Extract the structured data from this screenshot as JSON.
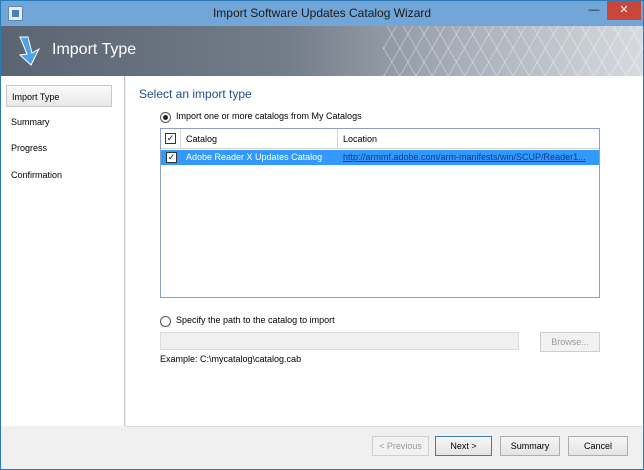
{
  "window": {
    "title": "Import Software Updates Catalog Wizard",
    "minimize_glyph": "—",
    "close_glyph": "✕"
  },
  "banner": {
    "title": "Import Type",
    "icon": "arrow-down-icon"
  },
  "sidebar": {
    "items": [
      {
        "label": "Import Type",
        "active": true
      },
      {
        "label": "Summary"
      },
      {
        "label": "Progress"
      },
      {
        "label": "Confirmation"
      }
    ]
  },
  "main": {
    "heading": "Select an import type",
    "option_mycatalogs": {
      "label": "Import one or more catalogs from My Catalogs",
      "selected": true
    },
    "table": {
      "columns": [
        "Catalog",
        "Location"
      ],
      "header_checked": true,
      "rows": [
        {
          "checked": true,
          "catalog": "Adobe Reader X Updates Catalog",
          "location": "http://armmf.adobe.com/arm-manifests/win/SCUP/Reader1..."
        }
      ]
    },
    "option_path": {
      "label": "Specify the path to the catalog to import",
      "selected": false
    },
    "path_value": "",
    "browse_label": "Browse...",
    "example_text": "Example: C:\\mycatalog\\catalog.cab"
  },
  "footer": {
    "previous_label": "< Previous",
    "next_label": "Next >",
    "summary_label": "Summary",
    "cancel_label": "Cancel"
  },
  "colors": {
    "selection": "#3399ff",
    "heading": "#1f4e8c",
    "titlebar": "#72a6d8"
  }
}
